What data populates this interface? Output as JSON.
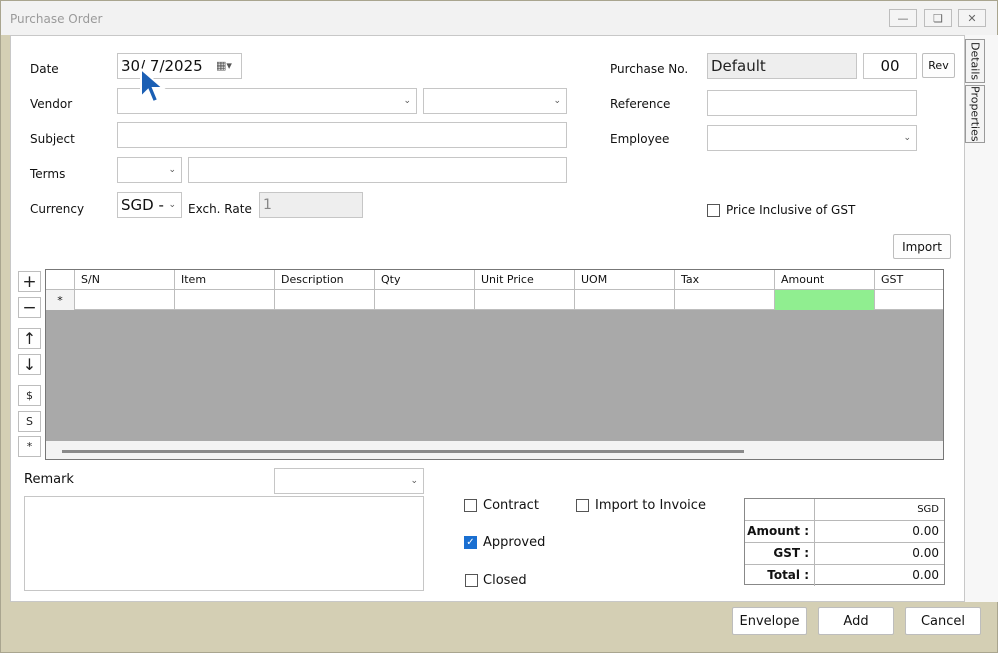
{
  "window": {
    "title": "Purchase Order"
  },
  "side_tabs": [
    "Details",
    "Properties"
  ],
  "form": {
    "date_label": "Date",
    "date_value": "30/ 7/2025",
    "vendor_label": "Vendor",
    "subject_label": "Subject",
    "terms_label": "Terms",
    "currency_label": "Currency",
    "currency_value": "SGD -",
    "exch_rate_label": "Exch. Rate",
    "exch_rate_value": "1",
    "purchase_no_label": "Purchase No.",
    "purchase_no_value": "Default",
    "purchase_no_suffix": "00",
    "rev_label": "Rev",
    "reference_label": "Reference",
    "employee_label": "Employee",
    "price_inclusive_label": "Price Inclusive of GST",
    "price_inclusive_checked": false,
    "import_label": "Import"
  },
  "grid": {
    "columns": [
      "S/N",
      "Item",
      "Description",
      "Qty",
      "Unit Price",
      "UOM",
      "Tax",
      "Amount",
      "GST"
    ],
    "new_row_marker": "*",
    "amount_cell_color": "#90ee90"
  },
  "grid_tools": [
    "+",
    "−",
    "↑",
    "↓",
    "$",
    "S",
    "*"
  ],
  "remark_label": "Remark",
  "options": {
    "contract_label": "Contract",
    "import_invoice_label": "Import to Invoice",
    "approved_label": "Approved",
    "closed_label": "Closed",
    "contract_checked": false,
    "import_invoice_checked": false,
    "approved_checked": true,
    "closed_checked": false
  },
  "totals": {
    "currency": "SGD",
    "amount_label": "Amount :",
    "amount_value": "0.00",
    "gst_label": "GST :",
    "gst_value": "0.00",
    "total_label": "Total :",
    "total_value": "0.00"
  },
  "footer": {
    "envelope_label": "Envelope",
    "add_label": "Add",
    "cancel_label": "Cancel"
  }
}
